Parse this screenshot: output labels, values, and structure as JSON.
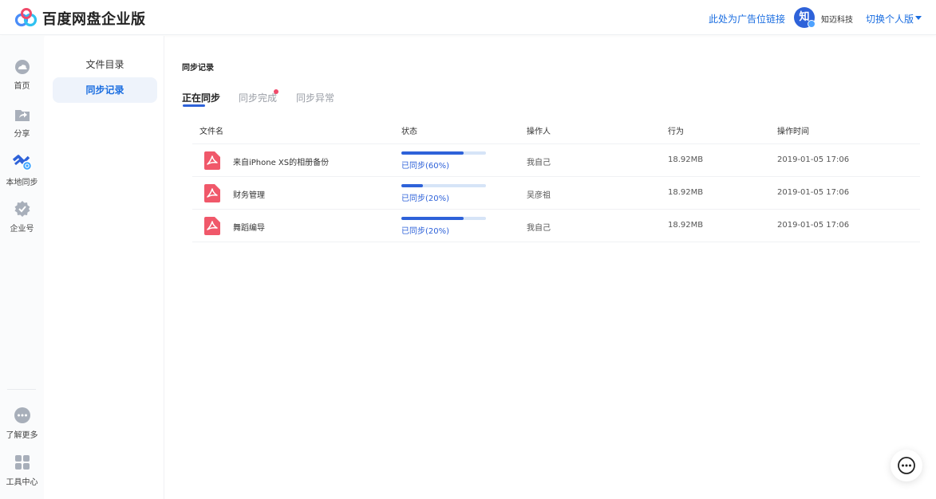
{
  "header": {
    "brand": "百度网盘企业版",
    "ad_link": "此处为广告位链接",
    "avatar_char": "知",
    "company": "知迈科技",
    "switch_label": "切换个人版"
  },
  "leftnav": {
    "items": [
      {
        "label": "首页",
        "icon": "cloud-icon"
      },
      {
        "label": "分享",
        "icon": "share-folder-icon"
      },
      {
        "label": "本地同步",
        "icon": "sync-icon"
      },
      {
        "label": "企业号",
        "icon": "enterprise-badge-icon"
      }
    ],
    "bottom_items": [
      {
        "label": "了解更多",
        "icon": "more-dots-icon"
      },
      {
        "label": "工具中心",
        "icon": "tools-grid-icon"
      }
    ]
  },
  "subnav": {
    "items": [
      {
        "label": "文件目录"
      },
      {
        "label": "同步记录",
        "active": true
      }
    ]
  },
  "main": {
    "title": "同步记录",
    "tabs": [
      {
        "label": "正在同步",
        "active": true
      },
      {
        "label": "同步完成",
        "has_dot": true
      },
      {
        "label": "同步异常"
      }
    ],
    "table": {
      "headers": [
        "文件名",
        "状态",
        "操作人",
        "行为",
        "操作时间"
      ],
      "rows": [
        {
          "name": "来自iPhone XS的相册备份",
          "progress": 0.74,
          "status": "已同步(60%)",
          "operator": "我自己",
          "action": "18.92MB",
          "time": "2019-01-05 17:06"
        },
        {
          "name": "财务管理",
          "progress": 0.25,
          "status": "已同步(20%)",
          "operator": "吴彦祖",
          "action": "18.92MB",
          "time": "2019-01-05 17:06"
        },
        {
          "name": "舞蹈编导",
          "progress": 0.74,
          "status": "已同步(20%)",
          "operator": "我自己",
          "action": "18.92MB",
          "time": "2019-01-05 17:06"
        }
      ]
    }
  },
  "colors": {
    "accent": "#2e62d9",
    "link": "#1a6de0",
    "pdf": "#f0586a",
    "dot": "#f04a6a"
  }
}
